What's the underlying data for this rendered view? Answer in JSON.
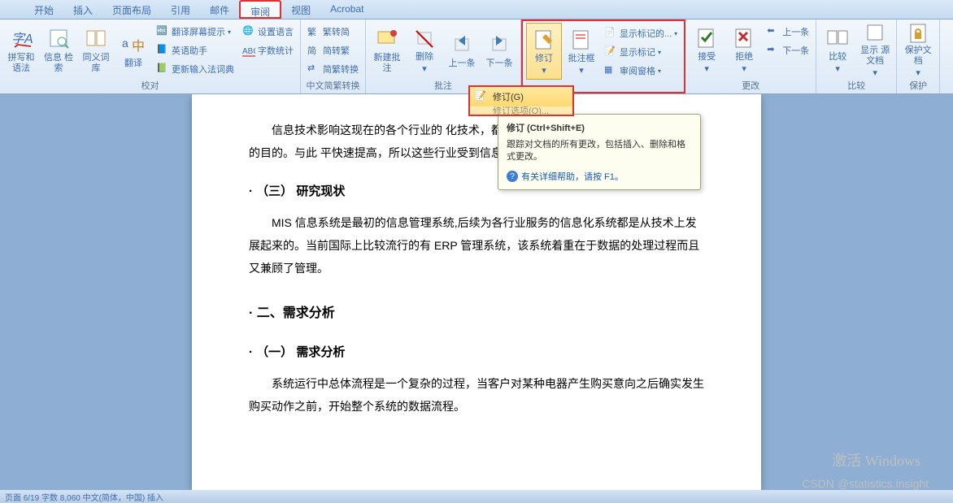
{
  "tabs": {
    "t0": "开始",
    "t1": "插入",
    "t2": "页面布局",
    "t3": "引用",
    "t4": "邮件",
    "t5": "审阅",
    "t6": "视图",
    "t7": "Acrobat"
  },
  "ribbon": {
    "g_proof": {
      "label": "校对",
      "spell": "拼写和\n语法",
      "search": "信息\n检索",
      "thesaurus": "同义词库",
      "translate": "翻译",
      "tip": "翻译屏幕提示",
      "eng": "英语助手",
      "ime": "更新输入法词典",
      "lang": "设置语言",
      "count": "字数统计"
    },
    "g_cn": {
      "label": "中文简繁转换",
      "t1": "繁转简",
      "t2": "简转繁",
      "t3": "简繁转换"
    },
    "g_comment": {
      "label": "批注",
      "new": "新建批注",
      "del": "删除",
      "prev": "上一条",
      "next": "下一条"
    },
    "g_track": {
      "label": "",
      "track": "修订",
      "balloon": "批注框",
      "s1": "显示标记的...",
      "s2": "显示标记",
      "s3": "审阅窗格"
    },
    "g_change": {
      "label": "更改",
      "accept": "接受",
      "reject": "拒绝",
      "prev": "上一条",
      "next": "下一条"
    },
    "g_compare": {
      "label": "比较",
      "compare": "比较",
      "src": "显示\n源文档"
    },
    "g_protect": {
      "label": "保护",
      "protect": "保护文档"
    }
  },
  "menu": {
    "m1": "修订(G)",
    "m2": "修订选项(O)..."
  },
  "tooltip": {
    "title": "修订 (Ctrl+Shift+E)",
    "body": "跟踪对文档的所有更改，包括插入、删除和格式更改。",
    "help": "有关详细帮助，请按 F1。"
  },
  "doc": {
    "p1": "信息技术影响这现在的各个行业的            化技术，都在一定程度上实现了提高生产经营效率的目的。与此            平快速提高，所以这些行业受到信息的影响也越来越大。",
    "h1": "（三） 研究现状",
    "p2": "MIS 信息系统是最初的信息管理系统,后续为各行业服务的信息化系统都是从技术上发展起来的。当前国际上比较流行的有 ERP 管理系统，该系统着重在于数据的处理过程而且又兼顾了管理。",
    "h2": "二、需求分析",
    "h3": "（一） 需求分析",
    "p3": "系统运行中总体流程是一个复杂的过程，当客户对某种电器产生购买意向之后确实发生购买动作之前，开始整个系统的数据流程。"
  },
  "wm1": "激活 Windows",
  "wm2": "CSDN @statistics.insight",
  "status": "页面  6/19    字数  8,060    中文(简体，中国)   插入"
}
